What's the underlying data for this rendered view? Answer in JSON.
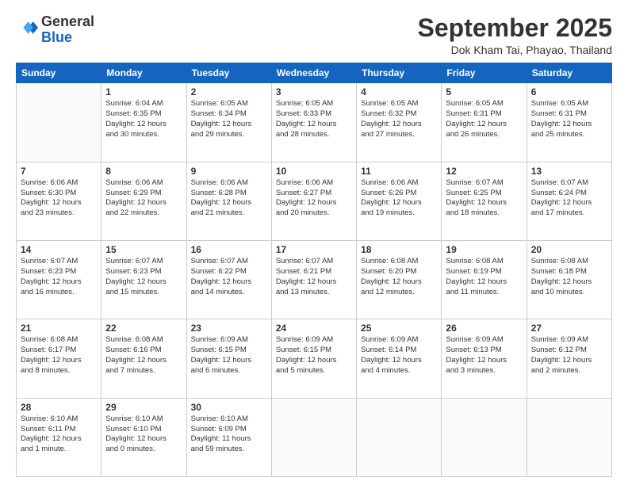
{
  "logo": {
    "general": "General",
    "blue": "Blue"
  },
  "title": "September 2025",
  "location": "Dok Kham Tai, Phayao, Thailand",
  "days_of_week": [
    "Sunday",
    "Monday",
    "Tuesday",
    "Wednesday",
    "Thursday",
    "Friday",
    "Saturday"
  ],
  "weeks": [
    [
      {
        "day": "",
        "info": ""
      },
      {
        "day": "1",
        "info": "Sunrise: 6:04 AM\nSunset: 6:35 PM\nDaylight: 12 hours\nand 30 minutes."
      },
      {
        "day": "2",
        "info": "Sunrise: 6:05 AM\nSunset: 6:34 PM\nDaylight: 12 hours\nand 29 minutes."
      },
      {
        "day": "3",
        "info": "Sunrise: 6:05 AM\nSunset: 6:33 PM\nDaylight: 12 hours\nand 28 minutes."
      },
      {
        "day": "4",
        "info": "Sunrise: 6:05 AM\nSunset: 6:32 PM\nDaylight: 12 hours\nand 27 minutes."
      },
      {
        "day": "5",
        "info": "Sunrise: 6:05 AM\nSunset: 6:31 PM\nDaylight: 12 hours\nand 26 minutes."
      },
      {
        "day": "6",
        "info": "Sunrise: 6:05 AM\nSunset: 6:31 PM\nDaylight: 12 hours\nand 25 minutes."
      }
    ],
    [
      {
        "day": "7",
        "info": "Sunrise: 6:06 AM\nSunset: 6:30 PM\nDaylight: 12 hours\nand 23 minutes."
      },
      {
        "day": "8",
        "info": "Sunrise: 6:06 AM\nSunset: 6:29 PM\nDaylight: 12 hours\nand 22 minutes."
      },
      {
        "day": "9",
        "info": "Sunrise: 6:06 AM\nSunset: 6:28 PM\nDaylight: 12 hours\nand 21 minutes."
      },
      {
        "day": "10",
        "info": "Sunrise: 6:06 AM\nSunset: 6:27 PM\nDaylight: 12 hours\nand 20 minutes."
      },
      {
        "day": "11",
        "info": "Sunrise: 6:06 AM\nSunset: 6:26 PM\nDaylight: 12 hours\nand 19 minutes."
      },
      {
        "day": "12",
        "info": "Sunrise: 6:07 AM\nSunset: 6:25 PM\nDaylight: 12 hours\nand 18 minutes."
      },
      {
        "day": "13",
        "info": "Sunrise: 6:07 AM\nSunset: 6:24 PM\nDaylight: 12 hours\nand 17 minutes."
      }
    ],
    [
      {
        "day": "14",
        "info": "Sunrise: 6:07 AM\nSunset: 6:23 PM\nDaylight: 12 hours\nand 16 minutes."
      },
      {
        "day": "15",
        "info": "Sunrise: 6:07 AM\nSunset: 6:23 PM\nDaylight: 12 hours\nand 15 minutes."
      },
      {
        "day": "16",
        "info": "Sunrise: 6:07 AM\nSunset: 6:22 PM\nDaylight: 12 hours\nand 14 minutes."
      },
      {
        "day": "17",
        "info": "Sunrise: 6:07 AM\nSunset: 6:21 PM\nDaylight: 12 hours\nand 13 minutes."
      },
      {
        "day": "18",
        "info": "Sunrise: 6:08 AM\nSunset: 6:20 PM\nDaylight: 12 hours\nand 12 minutes."
      },
      {
        "day": "19",
        "info": "Sunrise: 6:08 AM\nSunset: 6:19 PM\nDaylight: 12 hours\nand 11 minutes."
      },
      {
        "day": "20",
        "info": "Sunrise: 6:08 AM\nSunset: 6:18 PM\nDaylight: 12 hours\nand 10 minutes."
      }
    ],
    [
      {
        "day": "21",
        "info": "Sunrise: 6:08 AM\nSunset: 6:17 PM\nDaylight: 12 hours\nand 8 minutes."
      },
      {
        "day": "22",
        "info": "Sunrise: 6:08 AM\nSunset: 6:16 PM\nDaylight: 12 hours\nand 7 minutes."
      },
      {
        "day": "23",
        "info": "Sunrise: 6:09 AM\nSunset: 6:15 PM\nDaylight: 12 hours\nand 6 minutes."
      },
      {
        "day": "24",
        "info": "Sunrise: 6:09 AM\nSunset: 6:15 PM\nDaylight: 12 hours\nand 5 minutes."
      },
      {
        "day": "25",
        "info": "Sunrise: 6:09 AM\nSunset: 6:14 PM\nDaylight: 12 hours\nand 4 minutes."
      },
      {
        "day": "26",
        "info": "Sunrise: 6:09 AM\nSunset: 6:13 PM\nDaylight: 12 hours\nand 3 minutes."
      },
      {
        "day": "27",
        "info": "Sunrise: 6:09 AM\nSunset: 6:12 PM\nDaylight: 12 hours\nand 2 minutes."
      }
    ],
    [
      {
        "day": "28",
        "info": "Sunrise: 6:10 AM\nSunset: 6:11 PM\nDaylight: 12 hours\nand 1 minute."
      },
      {
        "day": "29",
        "info": "Sunrise: 6:10 AM\nSunset: 6:10 PM\nDaylight: 12 hours\nand 0 minutes."
      },
      {
        "day": "30",
        "info": "Sunrise: 6:10 AM\nSunset: 6:09 PM\nDaylight: 11 hours\nand 59 minutes."
      },
      {
        "day": "",
        "info": ""
      },
      {
        "day": "",
        "info": ""
      },
      {
        "day": "",
        "info": ""
      },
      {
        "day": "",
        "info": ""
      }
    ]
  ]
}
